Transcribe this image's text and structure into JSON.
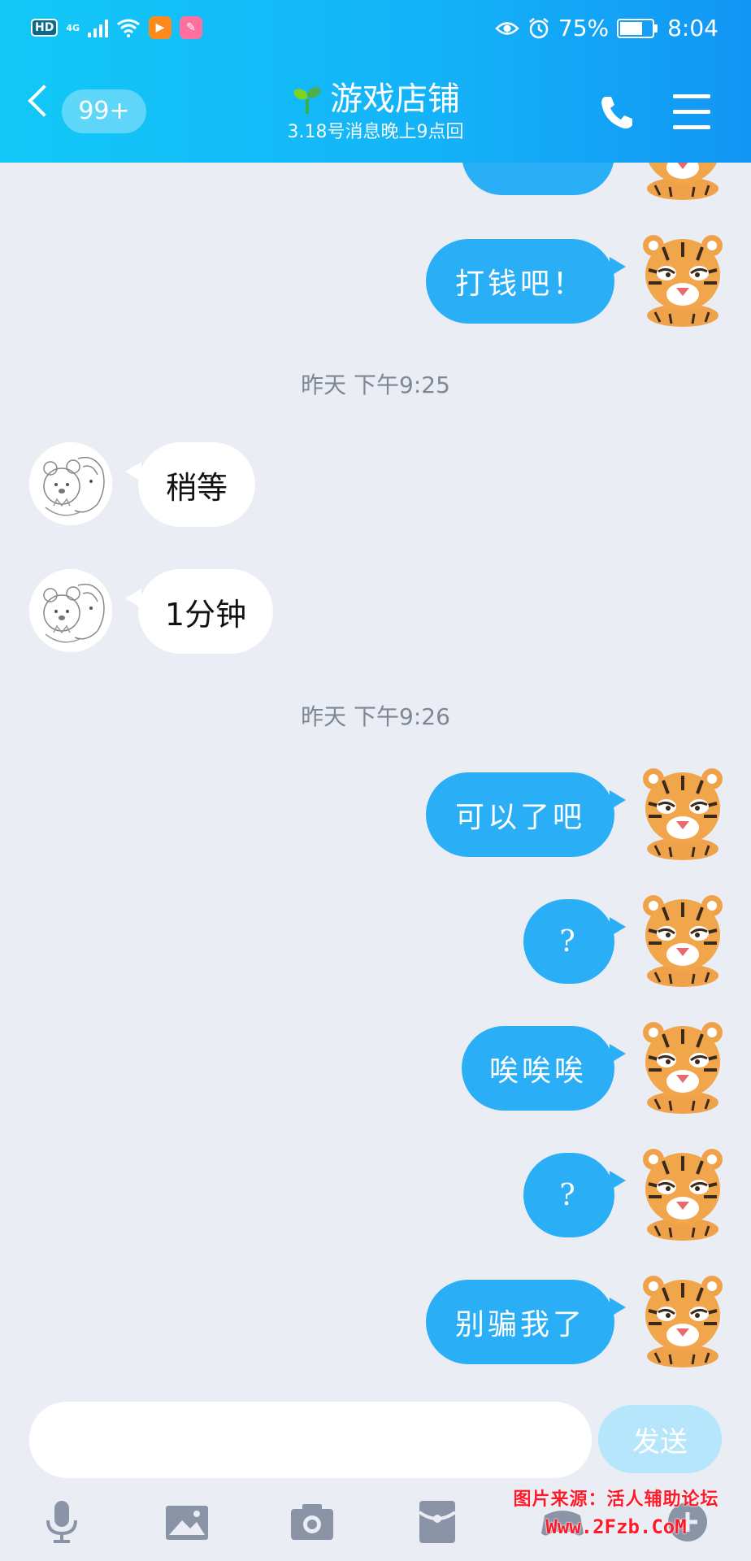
{
  "status_bar": {
    "hd": "HD",
    "network": "4G",
    "battery_text": "75%",
    "battery_level": 0.75,
    "time": "8:04"
  },
  "header": {
    "unread_badge": "99+",
    "title": "游戏店铺",
    "subtitle": "3.18号消息晚上9点回"
  },
  "messages": [
    {
      "sender": "me",
      "text": "打钱吧！"
    },
    {
      "type": "time",
      "text": "昨天 下午9:25"
    },
    {
      "sender": "other",
      "text": "稍等"
    },
    {
      "sender": "other",
      "text": "1分钟"
    },
    {
      "type": "time",
      "text": "昨天 下午9:26"
    },
    {
      "sender": "me",
      "text": "可以了吧"
    },
    {
      "sender": "me",
      "text": "?"
    },
    {
      "sender": "me",
      "text": "唉唉唉"
    },
    {
      "sender": "me",
      "text": "?"
    },
    {
      "sender": "me",
      "text": "别骗我了"
    }
  ],
  "input": {
    "value": "",
    "placeholder": "",
    "send_label": "发送"
  },
  "toolbar_icons": [
    "microphone-icon",
    "image-icon",
    "camera-icon",
    "red-packet-icon",
    "game-icon",
    "plus-icon"
  ],
  "watermark": {
    "line1": "图片来源：活人辅助论坛",
    "line2": "Www.2Fzb.CoM"
  },
  "colors": {
    "header_start": "#12c8f7",
    "header_end": "#1296f4",
    "my_bubble": "#2aaff7",
    "chat_background": "#eaedf4",
    "send_disabled": "#b6e6fb"
  }
}
